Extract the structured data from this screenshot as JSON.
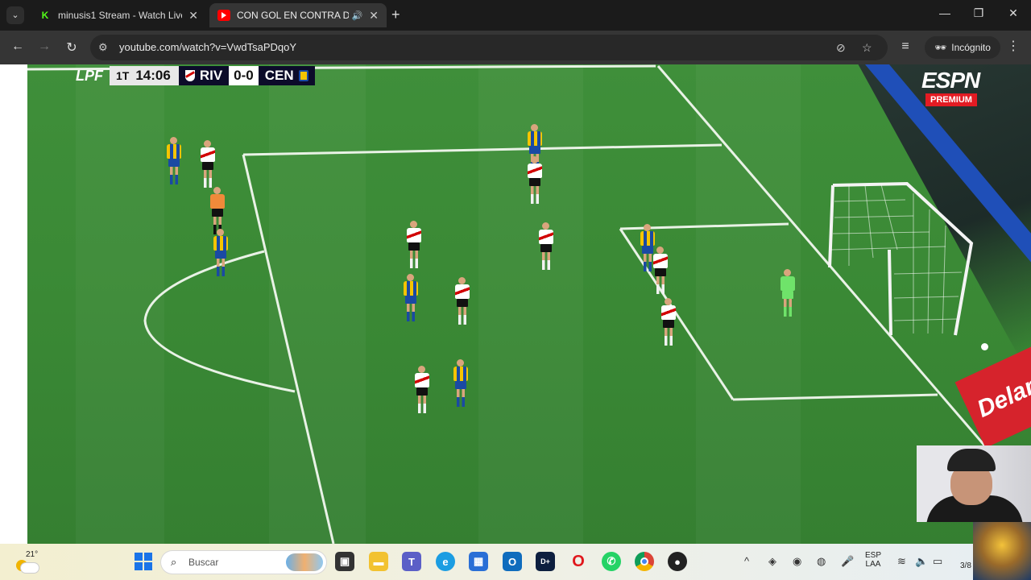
{
  "browser": {
    "tabs": [
      {
        "title": "minusis1 Stream - Watch Live o",
        "icon": "kick-icon",
        "active": false
      },
      {
        "title": "CON GOL EN CONTRA DE C",
        "icon": "youtube-icon",
        "active": true,
        "audio": "speaker-icon"
      }
    ],
    "url": "youtube.com/watch?v=VwdTsaPDqoY",
    "incognito_label": "Incógnito"
  },
  "video": {
    "scoreboard": {
      "league": "LPF",
      "period": "1T",
      "clock": "14:06",
      "home": "RIV",
      "score": "0-0",
      "away": "CEN"
    },
    "broadcaster": "ESPN",
    "broadcaster_tier": "PREMIUM",
    "ad_text": "Delan"
  },
  "taskbar": {
    "weather_temp": "21°",
    "search_placeholder": "Buscar",
    "language": "ESP",
    "layout": "LAA",
    "clock_partial": "3/8"
  },
  "colors": {
    "pitch": "#3a8935",
    "riv_shirt": "#ffffff",
    "cen_shirt": "#f5c400",
    "cen_secondary": "#1a4aa3",
    "gk_shirt": "#6fe36a",
    "espn_red": "#e31b23"
  }
}
